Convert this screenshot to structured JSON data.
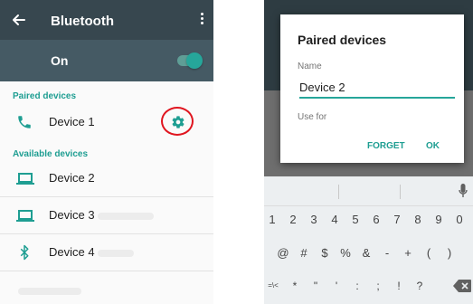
{
  "left_screen": {
    "toolbar": {
      "back_icon": "arrow-left-icon",
      "title": "Bluetooth",
      "menu_icon": "more-vert-icon"
    },
    "toggle": {
      "label": "On",
      "state": "on"
    },
    "paired_header": "Paired devices",
    "paired": [
      {
        "name": "Device 1",
        "icon": "phone-icon",
        "settings_icon": "gear-icon"
      }
    ],
    "available_header": "Available devices",
    "available": [
      {
        "name": "Device 2",
        "icon": "laptop-icon"
      },
      {
        "name": "Device 3",
        "icon": "laptop-icon"
      },
      {
        "name": "Device 4",
        "icon": "bluetooth-icon"
      }
    ],
    "colors": {
      "toolbar": "#37474f",
      "toggle_bar": "#455a64",
      "accent": "#1e9e92",
      "highlight_circle": "#e0151f"
    }
  },
  "right_screen": {
    "dialog": {
      "title": "Paired devices",
      "name_label": "Name",
      "name_value": "Device 2",
      "use_for_label": "Use for",
      "forget_button": "FORGET",
      "ok_button": "OK"
    },
    "keyboard": {
      "row1": [
        "1",
        "2",
        "3",
        "4",
        "5",
        "6",
        "7",
        "8",
        "9",
        "0"
      ],
      "row2": [
        "@",
        "#",
        "$",
        "%",
        "&",
        "-",
        "+",
        "(",
        ")"
      ],
      "row3": [
        "=\\<",
        "*",
        "\"",
        "'",
        ":",
        ";",
        "!",
        "?"
      ],
      "mic_icon": "mic-icon",
      "backspace_icon": "backspace-icon"
    }
  }
}
